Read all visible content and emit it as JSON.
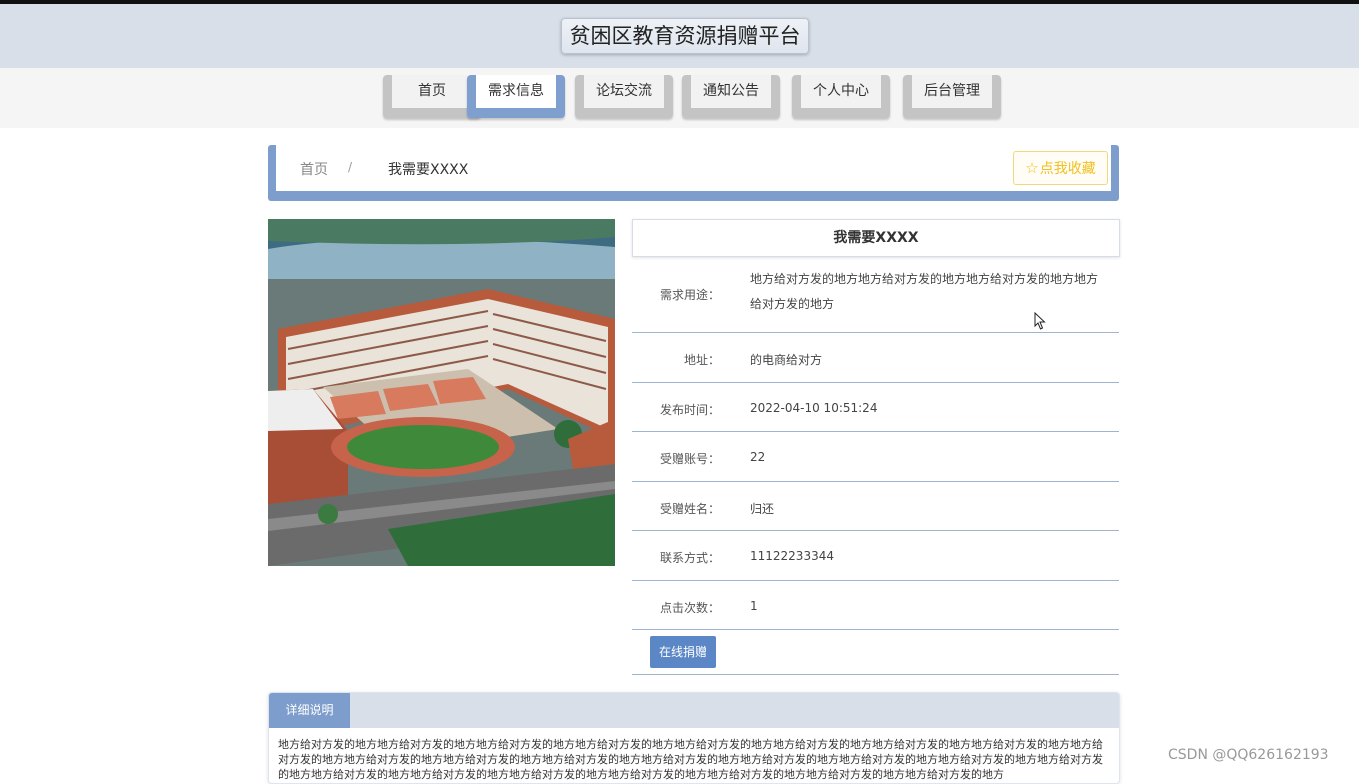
{
  "site": {
    "title": "贫困区教育资源捐赠平台"
  },
  "nav": {
    "items": [
      {
        "label": "首页"
      },
      {
        "label": "需求信息"
      },
      {
        "label": "论坛交流"
      },
      {
        "label": "通知公告"
      },
      {
        "label": "个人中心"
      },
      {
        "label": "后台管理"
      }
    ],
    "active": "需求信息"
  },
  "breadcrumb": {
    "home": "首页",
    "separator": "/",
    "current": "我需要XXXX"
  },
  "favorite": {
    "icon": "star-icon",
    "label": "点我收藏"
  },
  "detail": {
    "title": "我需要XXXX",
    "fields": [
      {
        "label": "需求用途：",
        "value": "地方给对方发的地方地方给对方发的地方地方给对方发的地方地方给对方发的地方"
      },
      {
        "label": "地址：",
        "value": "的电商给对方"
      },
      {
        "label": "发布时间：",
        "value": "2022-04-10 10:51:24"
      },
      {
        "label": "受赠账号：",
        "value": "22"
      },
      {
        "label": "受赠姓名：",
        "value": "归还"
      },
      {
        "label": "联系方式：",
        "value": "11122233344"
      },
      {
        "label": "点击次数：",
        "value": "1"
      }
    ],
    "donate_button": "在线捐赠"
  },
  "description": {
    "tab": "详细说明",
    "text": "地方给对方发的地方地方给对方发的地方地方给对方发的地方地方给对方发的地方地方给对方发的地方地方给对方发的地方地方给对方发的地方地方给对方发的地方地方给对方发的地方地方给对方发的地方地方给对方发的地方地方给对方发的地方地方给对方发的地方地方给对方发的地方地方给对方发的地方地方给对方发的地方地方给对方发的地方地方给对方发的地方地方给对方发的地方地方给对方发的地方地方给对方发的地方地方给对方发的地方地方给对方发的地方地方给对方发的地方"
  },
  "watermark": "CSDN @QQ626162193",
  "colors": {
    "accent": "#7d9dcc",
    "button": "#5b87c6",
    "favorite": "#f0c020",
    "header": "#d8dfe9"
  }
}
